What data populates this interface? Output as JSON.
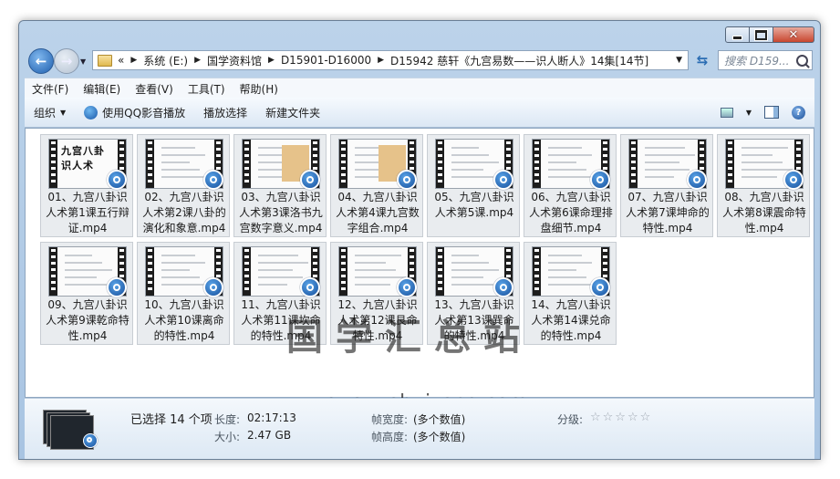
{
  "window": {
    "nav": {
      "back_icon": "back-arrow-icon",
      "forward_icon": "forward-arrow-icon",
      "breadcrumb": [
        "系统 (E:)",
        "国学资料馆",
        "D15901-D16000",
        "D15942 慈轩《九宫易数——识人断人》14集[14节]"
      ],
      "overflow": "«",
      "search_placeholder": "搜索 D159..."
    },
    "menu": [
      "文件(F)",
      "编辑(E)",
      "查看(V)",
      "工具(T)",
      "帮助(H)"
    ],
    "toolbar": {
      "organize": "组织",
      "play_qq": "使用QQ影音播放",
      "play_selection": "播放选择",
      "new_folder": "新建文件夹"
    },
    "files": [
      {
        "name": "01、九宫八卦识人术第1课五行辩证.mp4",
        "thumb_title": "九宫八卦 识人术"
      },
      {
        "name": "02、九宫八卦识人术第2课八卦的演化和象意.mp4",
        "thumb_title": ""
      },
      {
        "name": "03、九宫八卦识人术第3课洛书九宫数字意义.mp4",
        "thumb_title": ""
      },
      {
        "name": "04、九宫八卦识人术第4课九宫数字组合.mp4",
        "thumb_title": ""
      },
      {
        "name": "05、九宫八卦识人术第5课.mp4",
        "thumb_title": ""
      },
      {
        "name": "06、九宫八卦识人术第6课命理排盘细节.mp4",
        "thumb_title": ""
      },
      {
        "name": "07、九宫八卦识人术第7课坤命的特性.mp4",
        "thumb_title": ""
      },
      {
        "name": "08、九宫八卦识人术第8课震命特性.mp4",
        "thumb_title": ""
      },
      {
        "name": "09、九宫八卦识人术第9课乾命特性.mp4",
        "thumb_title": ""
      },
      {
        "name": "10、九宫八卦识人术第10课离命的特性.mp4",
        "thumb_title": ""
      },
      {
        "name": "11、九宫八卦识人术第11课坎命的特性.mp4",
        "thumb_title": ""
      },
      {
        "name": "12、九宫八卦识人术第12课艮命特性.mp4",
        "thumb_title": ""
      },
      {
        "name": "13、九宫八卦识人术第13课巽命的特性.mp4",
        "thumb_title": ""
      },
      {
        "name": "14、九宫八卦识人术第14课兑命的特性.mp4",
        "thumb_title": ""
      }
    ],
    "watermark": {
      "line1": "国学汇总站",
      "line2": "www.guoxuehuizong.com"
    },
    "details": {
      "selected": "已选择 14 个项",
      "length_label": "长度:",
      "length_value": "02:17:13",
      "size_label": "大小:",
      "size_value": "2.47 GB",
      "frame_width_label": "帧宽度:",
      "frame_width_value": "(多个数值)",
      "frame_height_label": "帧高度:",
      "frame_height_value": "(多个数值)",
      "rating_label": "分级:",
      "rating_stars": "☆☆☆☆☆"
    }
  }
}
